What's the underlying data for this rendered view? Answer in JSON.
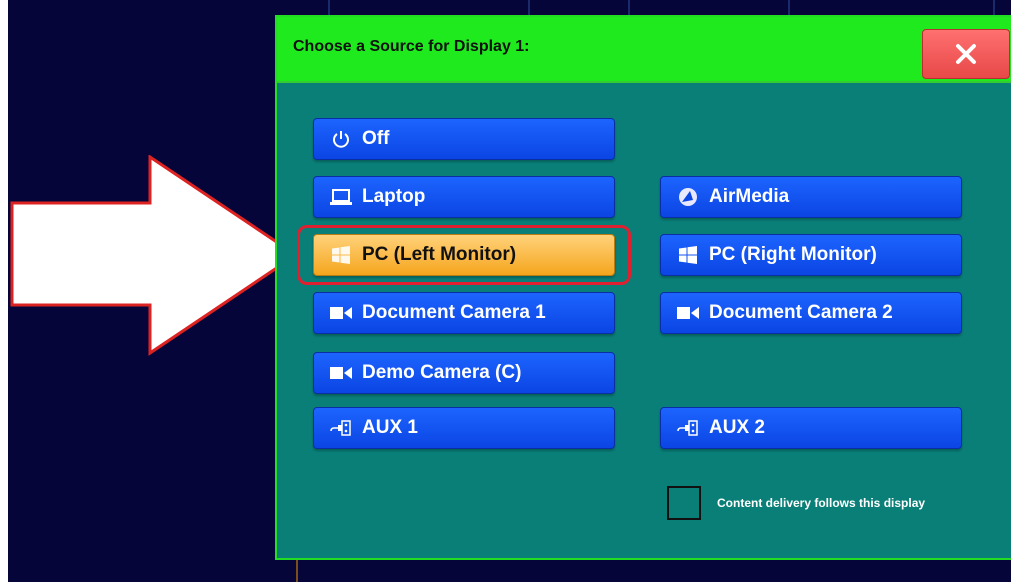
{
  "dialog": {
    "title": "Choose a Source for Display 1:",
    "close_icon": "close-icon"
  },
  "sources": {
    "off": {
      "label": "Off",
      "icon": "power-icon"
    },
    "laptop": {
      "label": "Laptop",
      "icon": "laptop-icon"
    },
    "airmedia": {
      "label": "AirMedia",
      "icon": "airmedia-icon"
    },
    "pc_left": {
      "label": "PC (Left Monitor)",
      "icon": "windows-icon",
      "selected": true
    },
    "pc_right": {
      "label": "PC (Right Monitor)",
      "icon": "windows-icon"
    },
    "doc_cam_1": {
      "label": "Document Camera 1",
      "icon": "camera-icon"
    },
    "doc_cam_2": {
      "label": "Document Camera 2",
      "icon": "camera-icon"
    },
    "demo_cam": {
      "label": "Demo Camera (C)",
      "icon": "camera-icon"
    },
    "aux1": {
      "label": "AUX 1",
      "icon": "aux-cable-icon"
    },
    "aux2": {
      "label": "AUX 2",
      "icon": "aux-cable-icon"
    }
  },
  "content_delivery": {
    "label": "Content delivery follows this display",
    "checked": false
  },
  "colors": {
    "dialog_bg": "#0a7f78",
    "titlebar_bg": "#1eea1e",
    "button_blue": "#1d64ff",
    "button_selected": "#f5a51d",
    "close_red": "#f05555",
    "highlight_red": "#e02030"
  }
}
